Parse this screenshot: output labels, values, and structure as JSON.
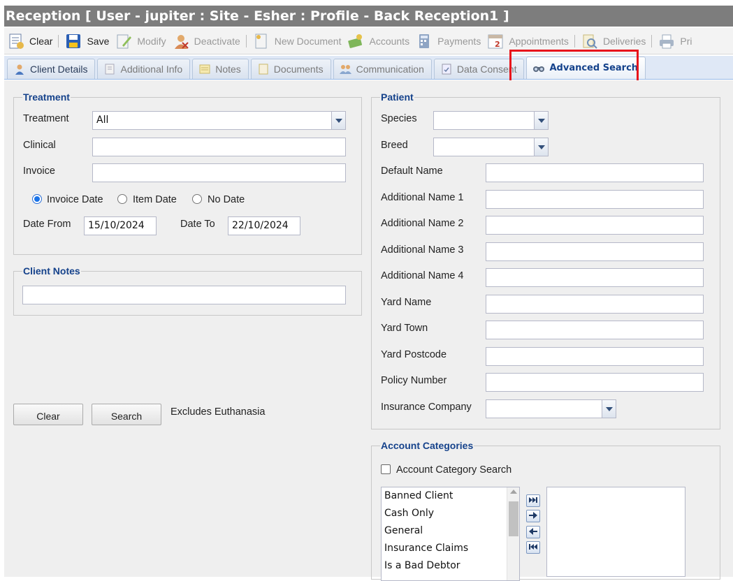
{
  "window": {
    "title": "Reception [ User - jupiter : Site - Esher : Profile - Back Reception1 ]"
  },
  "toolbar": {
    "clear": "Clear",
    "save": "Save",
    "modify": "Modify",
    "deactivate": "Deactivate",
    "new_document": "New Document",
    "accounts": "Accounts",
    "payments": "Payments",
    "appointments": "Appointments",
    "deliveries": "Deliveries",
    "print": "Pri"
  },
  "tabs": {
    "client_details": "Client Details",
    "additional_info": "Additional Info",
    "notes": "Notes",
    "documents": "Documents",
    "communication": "Communication",
    "data_consent": "Data Consent",
    "advanced_search": "Advanced Search"
  },
  "treatment": {
    "legend": "Treatment",
    "treatment_label": "Treatment",
    "treatment_value": "All",
    "clinical_label": "Clinical",
    "clinical_value": "",
    "invoice_label": "Invoice",
    "invoice_value": "",
    "radio_invoice_date": "Invoice Date",
    "radio_item_date": "Item Date",
    "radio_no_date": "No Date",
    "selected_radio": "Invoice Date",
    "date_from_label": "Date From",
    "date_from_value": "15/10/2024",
    "date_to_label": "Date To",
    "date_to_value": "22/10/2024"
  },
  "client_notes": {
    "legend": "Client Notes",
    "value": ""
  },
  "actions": {
    "clear": "Clear",
    "search": "Search",
    "note": "Excludes Euthanasia"
  },
  "patient": {
    "legend": "Patient",
    "species_label": "Species",
    "species_value": "",
    "breed_label": "Breed",
    "breed_value": "",
    "default_name_label": "Default Name",
    "additional_name_1_label": "Additional Name 1",
    "additional_name_2_label": "Additional Name 2",
    "additional_name_3_label": "Additional Name 3",
    "additional_name_4_label": "Additional Name 4",
    "yard_name_label": "Yard Name",
    "yard_town_label": "Yard Town",
    "yard_postcode_label": "Yard Postcode",
    "policy_number_label": "Policy Number",
    "insurance_company_label": "Insurance Company",
    "insurance_company_value": ""
  },
  "account_categories": {
    "legend": "Account Categories",
    "checkbox_label": "Account Category Search",
    "checked": false,
    "available": [
      "Banned Client",
      "Cash Only",
      "General",
      "Insurance Claims",
      "Is a Bad Debtor"
    ],
    "selected": []
  },
  "colors": {
    "highlight": "#e8141b",
    "legend": "#15428b",
    "titlebar": "#7d7d7d"
  }
}
